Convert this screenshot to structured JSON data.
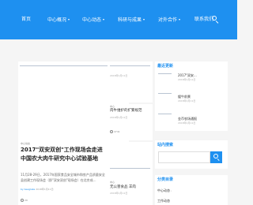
{
  "nav": {
    "items": [
      {
        "label": "首页"
      },
      {
        "label": "中心概况"
      },
      {
        "label": "中心动态"
      },
      {
        "label": "科研与成果"
      },
      {
        "label": "对外合作"
      },
      {
        "label": "联系我们"
      }
    ],
    "caret": "▾",
    "search_icon": "search-icon",
    "bg_color": "#1e90f0"
  },
  "featured": {
    "tag": "中心动态",
    "title": "2017\"双安双创\"工作现场会走进中国农大肉牛研究中心试验基地",
    "excerpt": "11月28-29日，2017年国家食品安全城市和农产品质量安全县创建工作现场会（即\"双安双创\"现场会）在北京成...",
    "author": "by beaglake",
    "date": "2018年1月11日",
    "counter": "29"
  },
  "posts": [
    {
      "meta": "2018年1月11日"
    },
    {
      "tag": "中心",
      "title": "肉牛维护的扩繁规范",
      "date": "2018年1月11日",
      "counter": "4741"
    },
    {
      "tag": "中心",
      "title": "无公害食品 羊肉",
      "date": "2018年1月11日"
    }
  ],
  "sidebar": {
    "recent_title": "最近更新",
    "recent": [
      {
        "title": "2017\"双安...",
        "date": "2018年1月11日"
      },
      {
        "title": "缓牛前景",
        "date": "2018年1月11日"
      },
      {
        "title": "金币农场通报",
        "date": "2018年1月11日"
      }
    ],
    "search_title": "站内搜索",
    "search_placeholder": "",
    "categories_title": "分类目录",
    "categories": [
      {
        "label": "中心动态"
      },
      {
        "label": "工作动态"
      }
    ],
    "accent_color": "#1e90f0"
  }
}
